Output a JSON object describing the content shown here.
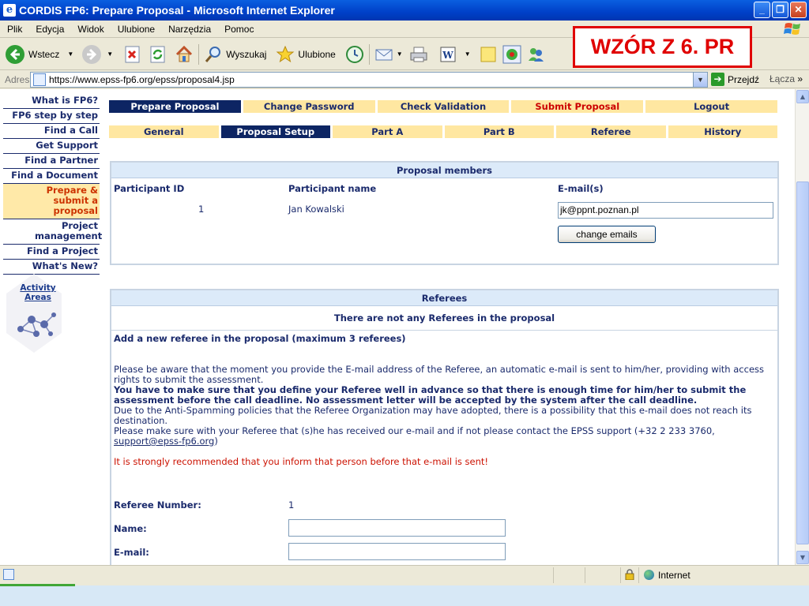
{
  "window": {
    "title": "CORDIS FP6: Prepare Proposal - Microsoft Internet Explorer",
    "controls": [
      "_",
      "❐",
      "✕"
    ]
  },
  "menu": [
    "Plik",
    "Edycja",
    "Widok",
    "Ulubione",
    "Narzędzia",
    "Pomoc"
  ],
  "toolbar": {
    "back_label": "Wstecz",
    "search_label": "Wyszukaj",
    "favorites_label": "Ulubione"
  },
  "overlay_label": "WZÓR Z 6. PR",
  "address": {
    "label": "Adres",
    "url": "https://www.epss-fp6.org/epss/proposal4.jsp",
    "go_label": "Przejdź",
    "links_label": "Łącza"
  },
  "leftnav": {
    "items": [
      {
        "label": "What is FP6?"
      },
      {
        "label": "FP6 step by step"
      },
      {
        "label": "Find a Call"
      },
      {
        "label": "Get Support"
      },
      {
        "label": "Find a Partner"
      },
      {
        "label": "Find a Document"
      },
      {
        "label": "Prepare & submit a proposal"
      },
      {
        "label": "Project management"
      },
      {
        "label": "Find a Project"
      },
      {
        "label": "What's New?"
      }
    ],
    "activity_label": "Activity Areas"
  },
  "tabs_top": [
    {
      "label": "Prepare Proposal"
    },
    {
      "label": "Change Password"
    },
    {
      "label": "Check Validation"
    },
    {
      "label": "Submit Proposal"
    },
    {
      "label": "Logout"
    }
  ],
  "tabs_sub": [
    {
      "label": "General"
    },
    {
      "label": "Proposal Setup"
    },
    {
      "label": "Part A"
    },
    {
      "label": "Part B"
    },
    {
      "label": "Referee"
    },
    {
      "label": "History"
    }
  ],
  "members": {
    "title": "Proposal members",
    "col_id": "Participant ID",
    "col_name": "Participant name",
    "col_email": "E-mail(s)",
    "row": {
      "id": "1",
      "name": "Jan Kowalski",
      "email": "jk@ppnt.poznan.pl"
    },
    "change_button": "change emails"
  },
  "referees": {
    "title": "Referees",
    "none_text": "There are not any Referees in the proposal",
    "add_title": "Add a new referee in the proposal (maximum 3 referees)",
    "para1": "Please be aware that the moment you provide the E-mail address of the Referee, an automatic e-mail is sent to him/her, providing with access rights to submit the assessment.",
    "para2": "You have to make sure that you define your Referee well in advance so that there is enough time for him/her to submit the assessment before the call deadline. No assessment letter will be accepted by the system after the call deadline.",
    "para3": "Due to the Anti-Spamming policies that the Referee Organization may have adopted, there is a possibility that this e-mail does not reach its destination.",
    "para4_text": "Please make sure with your Referee that (s)he has received our e-mail and if not please contact the EPSS support (+32 2 233 3760,",
    "support_email": "support@epss-fp6.org",
    "para4_end": ")",
    "warning": "It is strongly recommended that you inform that person before that e-mail is sent!",
    "number_label": "Referee Number:",
    "number_value": "1",
    "name_label": "Name:",
    "email_label": "E-mail:"
  },
  "status": {
    "zone": "Internet"
  }
}
